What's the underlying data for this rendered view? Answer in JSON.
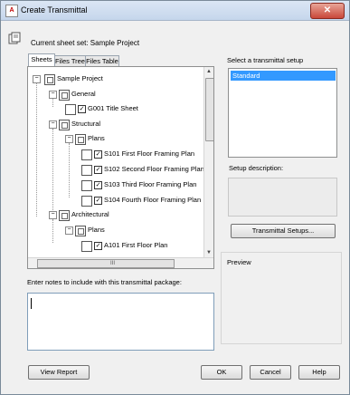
{
  "window": {
    "title": "Create Transmittal",
    "close_glyph": "✕",
    "app_icon_text": "A"
  },
  "sheet_set": {
    "label": "Current sheet set: Sample Project"
  },
  "tabs": [
    {
      "label": "Sheets",
      "active": true
    },
    {
      "label": "Files Tree",
      "active": false
    },
    {
      "label": "Files Table",
      "active": false
    }
  ],
  "tree": {
    "root": "Sample Project",
    "groups": [
      {
        "name": "General",
        "sheets": [
          "G001 Title Sheet"
        ]
      },
      {
        "name": "Structural",
        "subgroups": [
          {
            "name": "Plans",
            "sheets": [
              "S101 First Floor Framing Plan",
              "S102 Second Floor Framing Plan",
              "S103 Third Floor Framing Plan",
              "S104 Fourth Floor Framing Plan"
            ]
          }
        ]
      },
      {
        "name": "Architectural",
        "subgroups": [
          {
            "name": "Plans",
            "sheets": [
              "A101 First Floor Plan"
            ]
          }
        ]
      }
    ]
  },
  "scrollbar": {
    "grip": "III"
  },
  "notes": {
    "label": "Enter notes to include with this transmittal package:",
    "value": ""
  },
  "setup": {
    "label": "Select a transmittal setup",
    "items": [
      "Standard"
    ],
    "description_label": "Setup description:",
    "button": "Transmittal Setups..."
  },
  "preview": {
    "label": "Preview"
  },
  "buttons": {
    "view_report": "View Report",
    "ok": "OK",
    "cancel": "Cancel",
    "help": "Help"
  }
}
